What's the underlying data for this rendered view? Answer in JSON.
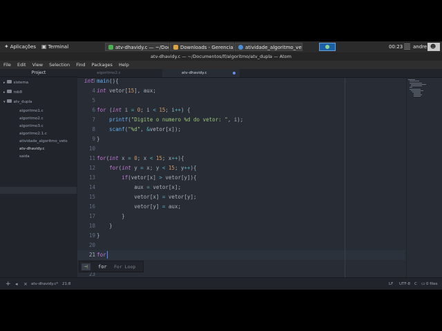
{
  "taskbar": {
    "apps_label": "Aplicações",
    "terminal_label": "Terminal",
    "tasks": [
      {
        "label": "atv-dhavidy.c — ~/Docu..."
      },
      {
        "label": "Downloads - Gerenciado..."
      },
      {
        "label": "atividade_algoritmo_vet..."
      }
    ],
    "clock": "00:23",
    "user": "andre"
  },
  "window": {
    "title": "atv-dhavidy.c — ~/Documentos/lf/algoritmo/atv_dupla — Atom"
  },
  "menu": [
    "File",
    "Edit",
    "View",
    "Selection",
    "Find",
    "Packages",
    "Help"
  ],
  "tree": {
    "header": "Project",
    "items": [
      {
        "label": "sistema",
        "type": "folder"
      },
      {
        "label": "rob8",
        "type": "folder"
      },
      {
        "label": "atv_dupla",
        "type": "folder"
      },
      {
        "label": "algoritmo1.c",
        "type": "file"
      },
      {
        "label": "algoritmo2.c",
        "type": "file"
      },
      {
        "label": "algoritmo3.c",
        "type": "file"
      },
      {
        "label": "algoritmo2.1.c",
        "type": "file"
      },
      {
        "label": "atividade_algoritmo_veto",
        "type": "file"
      },
      {
        "label": "atv-dhavidy.c",
        "type": "file"
      },
      {
        "label": "saida",
        "type": "file"
      }
    ]
  },
  "tabs": [
    {
      "label": "algoritmo2.c",
      "active": false
    },
    {
      "label": "atv-dhavidy.c",
      "active": true
    }
  ],
  "editor": {
    "current_line": 21,
    "lines": [
      {
        "num": "3",
        "tokens": [
          {
            "t": "int",
            "c": "ty"
          },
          {
            "t": " "
          },
          {
            "t": "main",
            "c": "fn"
          },
          {
            "t": "(){"
          }
        ]
      },
      {
        "num": "4",
        "tokens": [
          {
            "t": "    "
          },
          {
            "t": "int",
            "c": "ty"
          },
          {
            "t": " vetor["
          },
          {
            "t": "15",
            "c": "num"
          },
          {
            "t": "], aux;"
          }
        ]
      },
      {
        "num": "5",
        "tokens": []
      },
      {
        "num": "6",
        "tokens": [
          {
            "t": "    "
          },
          {
            "t": "for",
            "c": "kw"
          },
          {
            "t": " ("
          },
          {
            "t": "int",
            "c": "ty"
          },
          {
            "t": " i "
          },
          {
            "t": "=",
            "c": "op"
          },
          {
            "t": " "
          },
          {
            "t": "0",
            "c": "num"
          },
          {
            "t": "; i "
          },
          {
            "t": "<",
            "c": "op"
          },
          {
            "t": " "
          },
          {
            "t": "15",
            "c": "num"
          },
          {
            "t": "; i"
          },
          {
            "t": "++",
            "c": "op"
          },
          {
            "t": ") {"
          }
        ]
      },
      {
        "num": "7",
        "tokens": [
          {
            "t": "        "
          },
          {
            "t": "printf",
            "c": "fn"
          },
          {
            "t": "("
          },
          {
            "t": "\"Digite o numero %d do vetor: \"",
            "c": "str"
          },
          {
            "t": ", i);"
          }
        ]
      },
      {
        "num": "8",
        "tokens": [
          {
            "t": "        "
          },
          {
            "t": "scanf",
            "c": "fn"
          },
          {
            "t": "("
          },
          {
            "t": "\"%d\"",
            "c": "str"
          },
          {
            "t": ", "
          },
          {
            "t": "&",
            "c": "op"
          },
          {
            "t": "vetor[x]);"
          }
        ]
      },
      {
        "num": "9",
        "tokens": [
          {
            "t": "    }"
          }
        ]
      },
      {
        "num": "10",
        "tokens": []
      },
      {
        "num": "11",
        "tokens": [
          {
            "t": "    "
          },
          {
            "t": "for",
            "c": "kw"
          },
          {
            "t": "("
          },
          {
            "t": "int",
            "c": "ty"
          },
          {
            "t": " x "
          },
          {
            "t": "=",
            "c": "op"
          },
          {
            "t": " "
          },
          {
            "t": "0",
            "c": "num"
          },
          {
            "t": "; x "
          },
          {
            "t": "<",
            "c": "op"
          },
          {
            "t": " "
          },
          {
            "t": "15",
            "c": "num"
          },
          {
            "t": "; x"
          },
          {
            "t": "++",
            "c": "op"
          },
          {
            "t": "){"
          }
        ]
      },
      {
        "num": "12",
        "tokens": [
          {
            "t": "        "
          },
          {
            "t": "for",
            "c": "kw"
          },
          {
            "t": "("
          },
          {
            "t": "int",
            "c": "ty"
          },
          {
            "t": " y "
          },
          {
            "t": "=",
            "c": "op"
          },
          {
            "t": " x; y "
          },
          {
            "t": "<",
            "c": "op"
          },
          {
            "t": " "
          },
          {
            "t": "15",
            "c": "num"
          },
          {
            "t": "; y"
          },
          {
            "t": "++",
            "c": "op"
          },
          {
            "t": "){"
          }
        ]
      },
      {
        "num": "13",
        "tokens": [
          {
            "t": "            "
          },
          {
            "t": "if",
            "c": "kw"
          },
          {
            "t": "(vetor[x] "
          },
          {
            "t": ">",
            "c": "op"
          },
          {
            "t": " vetor[y]){"
          }
        ]
      },
      {
        "num": "14",
        "tokens": [
          {
            "t": "                aux "
          },
          {
            "t": "=",
            "c": "op"
          },
          {
            "t": " vetor[x];"
          }
        ]
      },
      {
        "num": "15",
        "tokens": [
          {
            "t": "                vetor[x] "
          },
          {
            "t": "=",
            "c": "op"
          },
          {
            "t": " vetor[y];"
          }
        ]
      },
      {
        "num": "16",
        "tokens": [
          {
            "t": "                vetor[y] "
          },
          {
            "t": "=",
            "c": "op"
          },
          {
            "t": " aux;"
          }
        ]
      },
      {
        "num": "17",
        "tokens": [
          {
            "t": "            }"
          }
        ]
      },
      {
        "num": "18",
        "tokens": [
          {
            "t": "        }"
          }
        ]
      },
      {
        "num": "19",
        "tokens": [
          {
            "t": "    }"
          }
        ]
      },
      {
        "num": "20",
        "tokens": []
      },
      {
        "num": "21",
        "tokens": [
          {
            "t": "    "
          },
          {
            "t": "for",
            "c": "kw"
          }
        ]
      },
      {
        "num": "22",
        "tokens": []
      },
      {
        "num": "23",
        "tokens": []
      }
    ]
  },
  "autocomplete": {
    "badge": "→|",
    "word": "for",
    "description": "For Loop"
  },
  "status": {
    "file": "atv-dhavidy.c*",
    "position": "21:8",
    "line_ending": "LF",
    "encoding": "UTF-8",
    "grammar": "C",
    "files": "0 files"
  }
}
